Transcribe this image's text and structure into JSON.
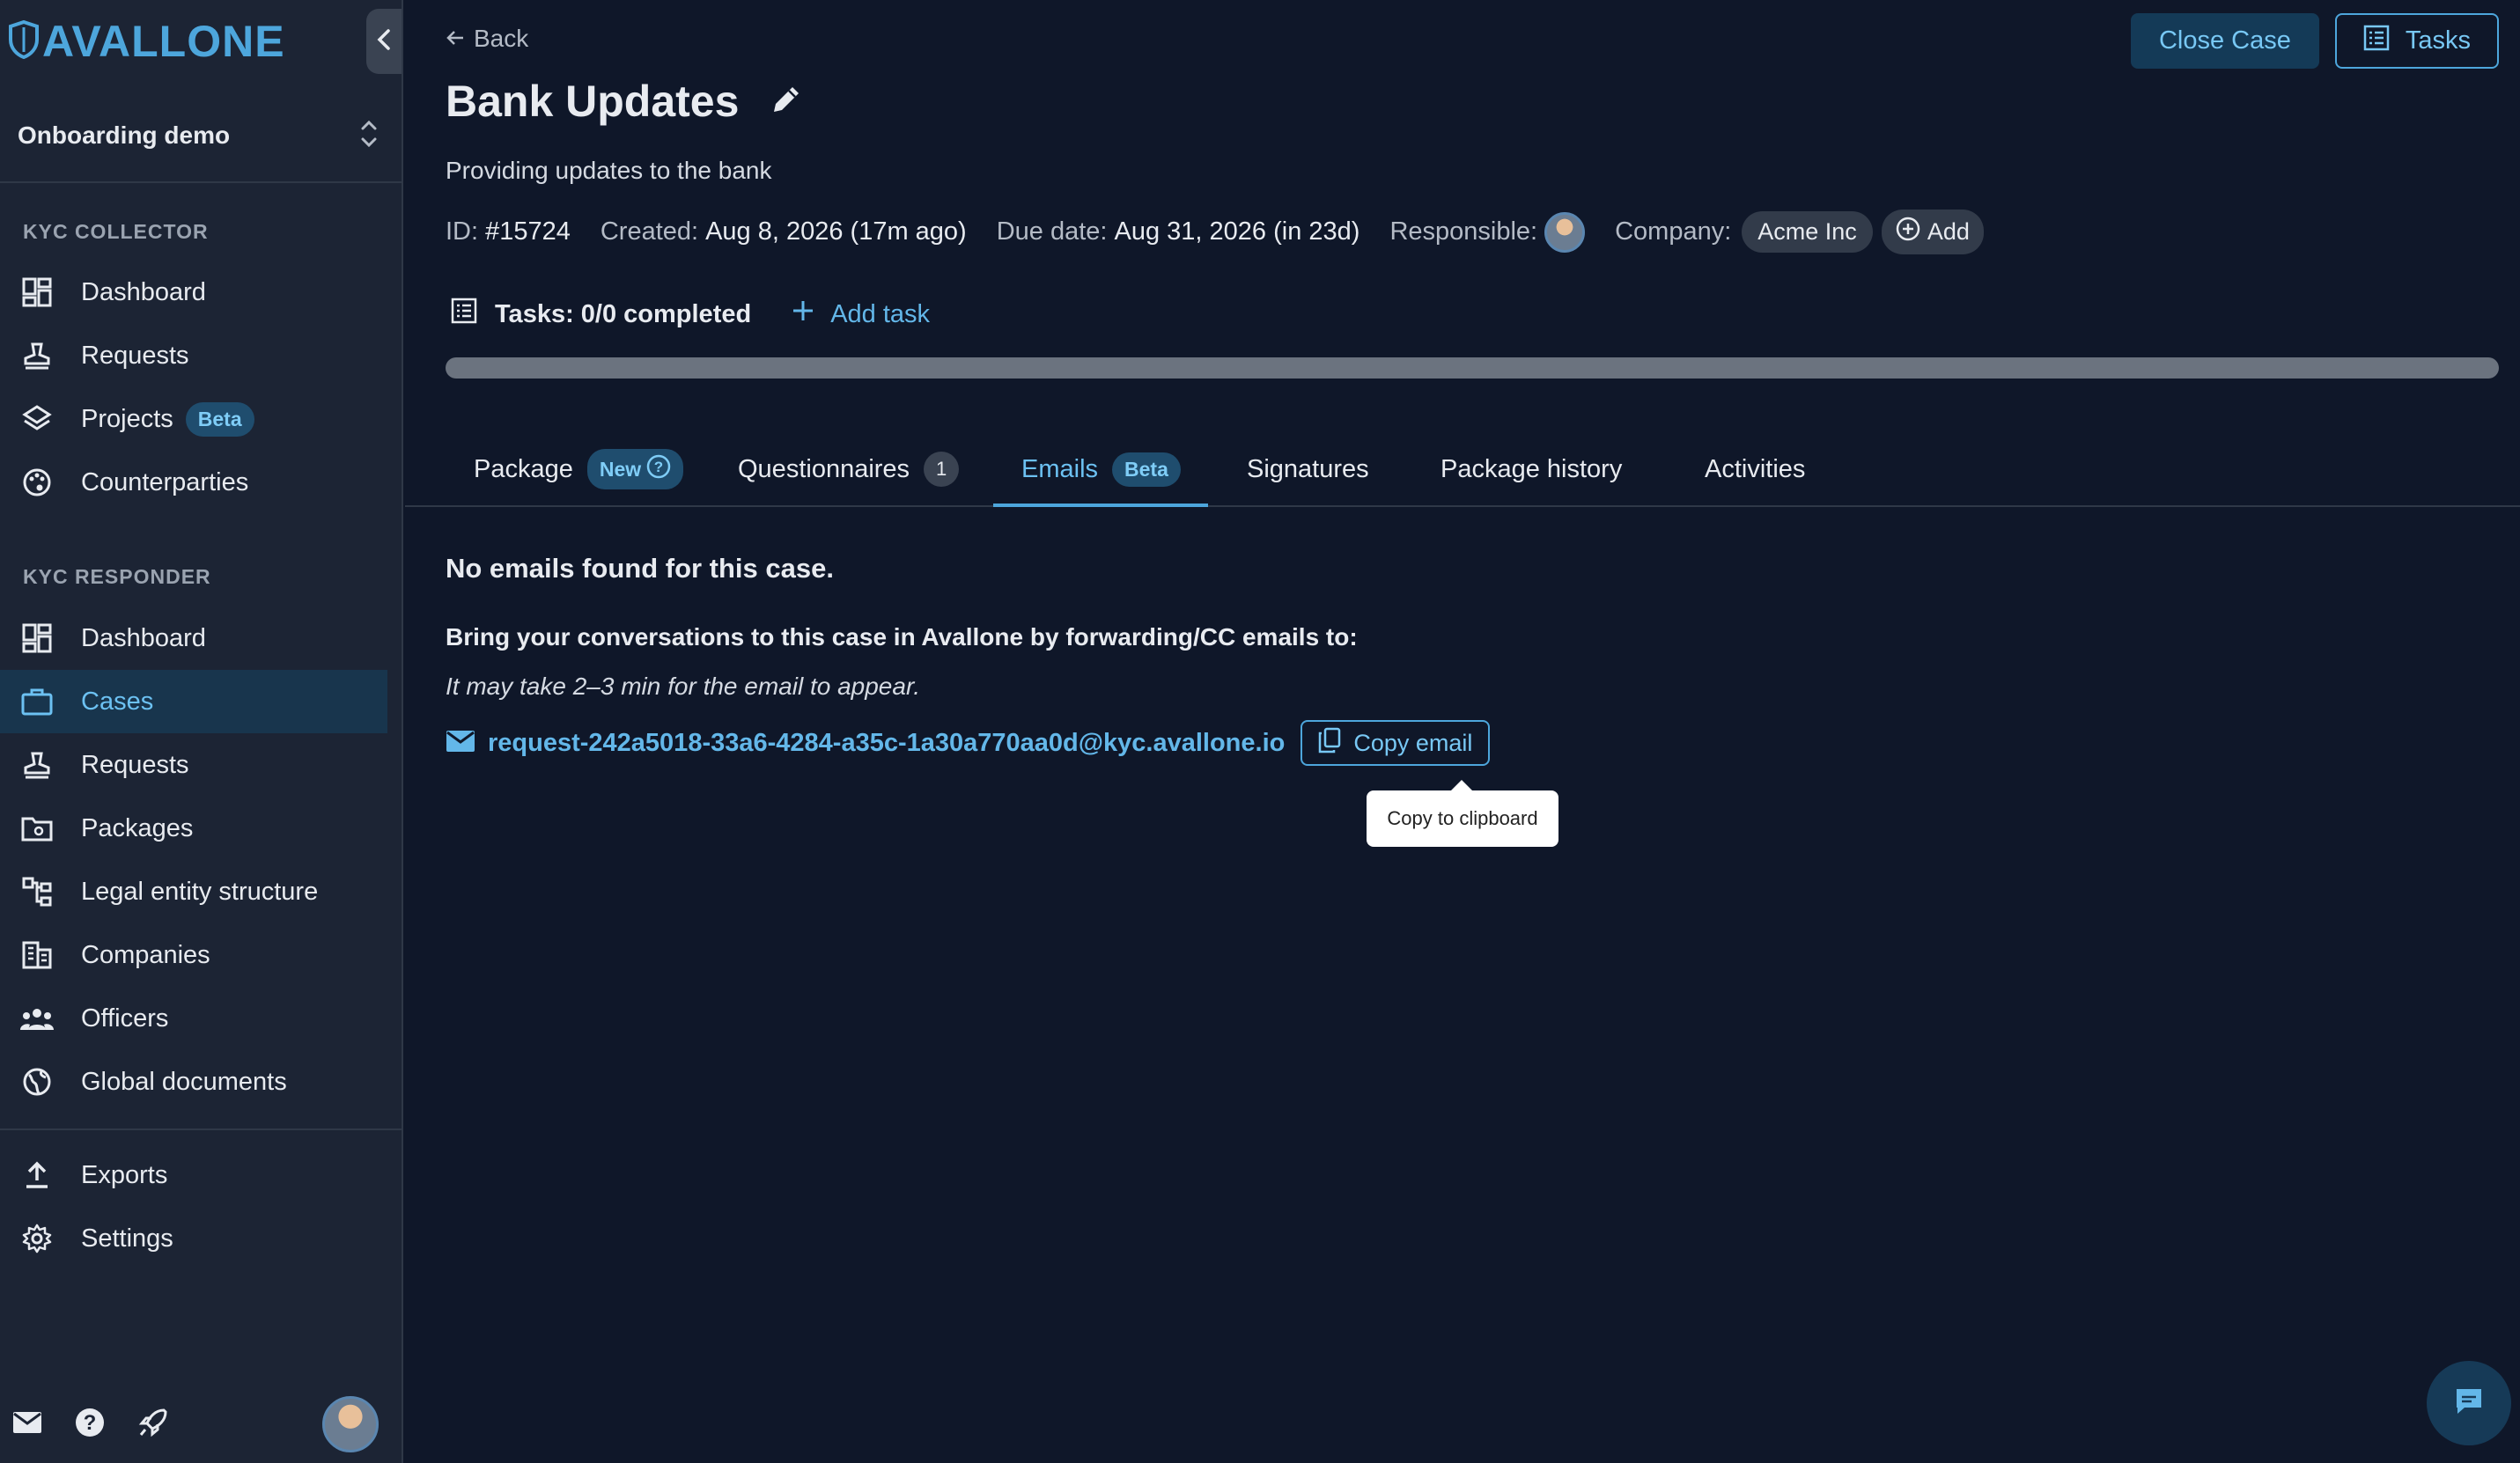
{
  "brand": {
    "name": "AVALLONE",
    "color": "#4da6dc"
  },
  "workspace": {
    "name": "Onboarding demo"
  },
  "sidebar": {
    "collector_label": "KYC COLLECTOR",
    "collector_items": [
      {
        "label": "Dashboard",
        "icon": "dashboard-icon"
      },
      {
        "label": "Requests",
        "icon": "stamp-icon"
      },
      {
        "label": "Projects",
        "icon": "layers-icon",
        "badge": "Beta"
      },
      {
        "label": "Counterparties",
        "icon": "palette-icon"
      }
    ],
    "responder_label": "KYC RESPONDER",
    "responder_items": [
      {
        "label": "Dashboard",
        "icon": "dashboard-icon"
      },
      {
        "label": "Cases",
        "icon": "briefcase-icon",
        "active": true
      },
      {
        "label": "Requests",
        "icon": "stamp-icon"
      },
      {
        "label": "Packages",
        "icon": "folder-icon"
      },
      {
        "label": "Legal entity structure",
        "icon": "tree-icon"
      },
      {
        "label": "Companies",
        "icon": "building-icon"
      },
      {
        "label": "Officers",
        "icon": "people-icon"
      },
      {
        "label": "Global documents",
        "icon": "globe-icon"
      }
    ],
    "footer_items": [
      {
        "label": "Exports",
        "icon": "upload-icon"
      },
      {
        "label": "Settings",
        "icon": "gear-icon"
      }
    ]
  },
  "header": {
    "back_label": "Back",
    "close_case_label": "Close Case",
    "tasks_button_label": "Tasks"
  },
  "case": {
    "title": "Bank Updates",
    "description": "Providing updates to the bank",
    "id_label": "ID:",
    "id_value": "#15724",
    "created_label": "Created:",
    "created_value": "Aug 8, 2026 (17m ago)",
    "due_label": "Due date:",
    "due_value": "Aug 31, 2026 (in 23d)",
    "responsible_label": "Responsible:",
    "company_label": "Company:",
    "company_value": "Acme Inc",
    "add_company_label": "Add"
  },
  "tasks": {
    "label": "Tasks: 0/0 completed",
    "add_label": "Add task",
    "progress_fraction": 0
  },
  "tabs": [
    {
      "label": "Package",
      "badge": "New"
    },
    {
      "label": "Questionnaires",
      "count": "1"
    },
    {
      "label": "Emails",
      "badge": "Beta",
      "active": true
    },
    {
      "label": "Signatures"
    },
    {
      "label": "Package history"
    },
    {
      "label": "Activities"
    }
  ],
  "emails": {
    "empty_title": "No emails found for this case.",
    "instructions": "Bring your conversations to this case in Avallone by forwarding/CC emails to:",
    "hint": "It may take 2–3 min for the email to appear.",
    "address": "request-242a5018-33a6-4284-a35c-1a30a770aa0d@kyc.avallone.io",
    "copy_label": "Copy email",
    "tooltip": "Copy to clipboard"
  }
}
